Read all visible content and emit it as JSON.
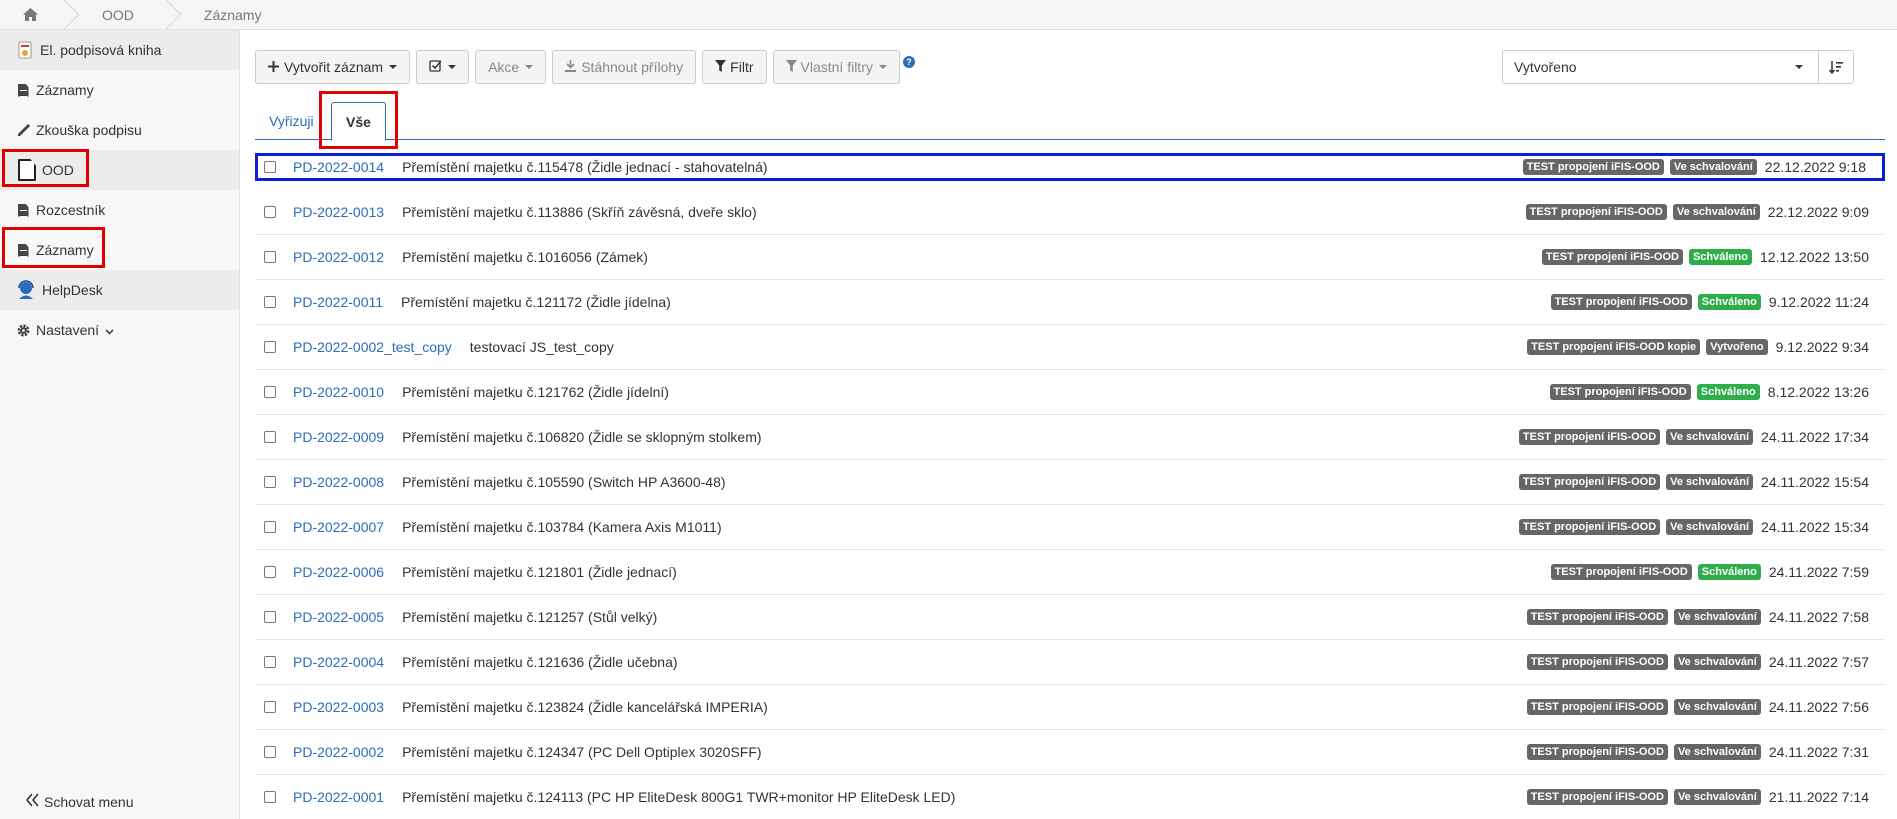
{
  "breadcrumb": {
    "items": [
      "OOD",
      "Záznamy"
    ]
  },
  "sidebar": {
    "items": [
      {
        "label": "El. podpisová kniha",
        "type": "header"
      },
      {
        "label": "Záznamy",
        "type": "item"
      },
      {
        "label": "Zkouška podpisu",
        "type": "item"
      },
      {
        "label": "OOD",
        "type": "header"
      },
      {
        "label": "Rozcestník",
        "type": "item"
      },
      {
        "label": "Záznamy",
        "type": "item"
      },
      {
        "label": "HelpDesk",
        "type": "header"
      },
      {
        "label": "Nastavení",
        "type": "item"
      }
    ],
    "footer": "Schovat menu"
  },
  "toolbar": {
    "create": "Vytvořit záznam",
    "actions": "Akce",
    "download": "Stáhnout přílohy",
    "filter": "Filtr",
    "custom_filters": "Vlastní filtry",
    "help": "?"
  },
  "sort": {
    "value": "Vytvořeno"
  },
  "tabs": [
    {
      "label": "Vyřizuji",
      "active": false
    },
    {
      "label": "Vše",
      "active": true
    }
  ],
  "records": [
    {
      "id": "PD-2022-0014",
      "title": "Přemístění majetku č.115478 (Židle jednací - stahovatelná)",
      "tag": "TEST propojení iFIS-OOD",
      "status": "Ve schvalování",
      "date": "22.12.2022 9:18"
    },
    {
      "id": "PD-2022-0013",
      "title": "Přemístění majetku č.113886 (Skříň závěsná, dveře sklo)",
      "tag": "TEST propojení iFIS-OOD",
      "status": "Ve schvalování",
      "date": "22.12.2022 9:09"
    },
    {
      "id": "PD-2022-0012",
      "title": "Přemístění majetku č.1016056 (Zámek)",
      "tag": "TEST propojení iFIS-OOD",
      "status": "Schváleno",
      "date": "12.12.2022 13:50"
    },
    {
      "id": "PD-2022-0011",
      "title": "Přemístění majetku č.121172 (Židle jídelna)",
      "tag": "TEST propojení iFIS-OOD",
      "status": "Schváleno",
      "date": "9.12.2022 11:24"
    },
    {
      "id": "PD-2022-0002_test_copy",
      "title": "testovací JS_test_copy",
      "tag": "TEST propojení iFIS-OOD kopie",
      "status": "Vytvořeno",
      "date": "9.12.2022 9:34"
    },
    {
      "id": "PD-2022-0010",
      "title": "Přemístění majetku č.121762 (Židle jídelní)",
      "tag": "TEST propojení iFIS-OOD",
      "status": "Schváleno",
      "date": "8.12.2022 13:26"
    },
    {
      "id": "PD-2022-0009",
      "title": "Přemístění majetku č.106820 (Židle se sklopným stolkem)",
      "tag": "TEST propojení iFIS-OOD",
      "status": "Ve schvalování",
      "date": "24.11.2022 17:34"
    },
    {
      "id": "PD-2022-0008",
      "title": "Přemístění majetku č.105590 (Switch HP A3600-48)",
      "tag": "TEST propojení iFIS-OOD",
      "status": "Ve schvalování",
      "date": "24.11.2022 15:54"
    },
    {
      "id": "PD-2022-0007",
      "title": "Přemístění majetku č.103784 (Kamera Axis M1011)",
      "tag": "TEST propojení iFIS-OOD",
      "status": "Ve schvalování",
      "date": "24.11.2022 15:34"
    },
    {
      "id": "PD-2022-0006",
      "title": "Přemístění majetku č.121801 (Židle jednací)",
      "tag": "TEST propojení iFIS-OOD",
      "status": "Schváleno",
      "date": "24.11.2022 7:59"
    },
    {
      "id": "PD-2022-0005",
      "title": "Přemístění majetku č.121257 (Stůl velký)",
      "tag": "TEST propojení iFIS-OOD",
      "status": "Ve schvalování",
      "date": "24.11.2022 7:58"
    },
    {
      "id": "PD-2022-0004",
      "title": "Přemístění majetku č.121636 (Židle učebna)",
      "tag": "TEST propojení iFIS-OOD",
      "status": "Ve schvalování",
      "date": "24.11.2022 7:57"
    },
    {
      "id": "PD-2022-0003",
      "title": "Přemístění majetku č.123824 (Židle kancelářská IMPERIA)",
      "tag": "TEST propojení iFIS-OOD",
      "status": "Ve schvalování",
      "date": "24.11.2022 7:56"
    },
    {
      "id": "PD-2022-0002",
      "title": "Přemístění majetku č.124347 (PC Dell Optiplex 3020SFF)",
      "tag": "TEST propojení iFIS-OOD",
      "status": "Ve schvalování",
      "date": "24.11.2022 7:31"
    },
    {
      "id": "PD-2022-0001",
      "title": "Přemístění majetku č.124113 (PC HP EliteDesk 800G1 TWR+monitor HP EliteDesk LED)",
      "tag": "TEST propojení iFIS-OOD",
      "status": "Ve schvalování",
      "date": "21.11.2022 7:14"
    }
  ],
  "colors": {
    "link": "#2a6ebb",
    "badge_gray": "#666666",
    "badge_green": "#2eae4a",
    "highlight_red": "#e00000",
    "highlight_blue": "#0a1fd6"
  }
}
